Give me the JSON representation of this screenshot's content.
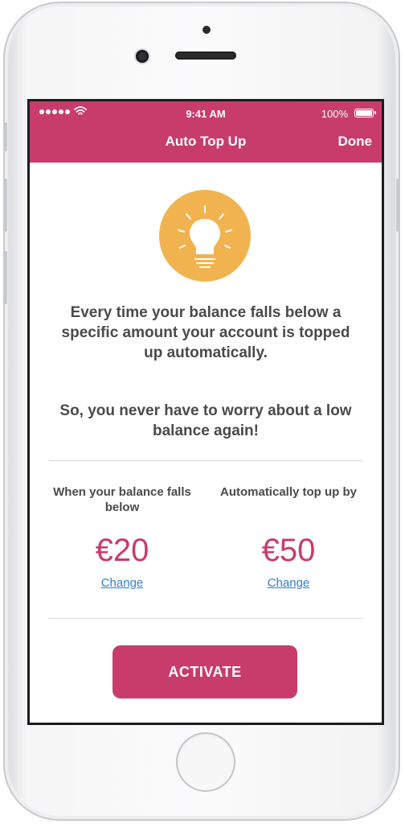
{
  "status_bar": {
    "time": "9:41 AM",
    "battery_percent": "100%",
    "signal_icon": "signal-dots-icon",
    "wifi_icon": "wifi-icon",
    "battery_icon": "battery-icon"
  },
  "nav": {
    "title": "Auto Top Up",
    "done_label": "Done"
  },
  "hero": {
    "icon": "lightbulb-icon",
    "icon_background": "#f1b34f"
  },
  "intro": {
    "line1": "Every time your balance falls below a specific amount your account is topped up automatically.",
    "line2": "So, you never have to worry about a low balance again!"
  },
  "threshold": {
    "label": "When your balance falls below",
    "amount": "€20",
    "change_label": "Change"
  },
  "topup": {
    "label": "Automatically top up by",
    "amount": "€50",
    "change_label": "Change"
  },
  "actions": {
    "activate_label": "ACTIVATE"
  },
  "colors": {
    "accent": "#c83c6b",
    "link": "#2f7fd6",
    "text": "#4a4a4a"
  }
}
